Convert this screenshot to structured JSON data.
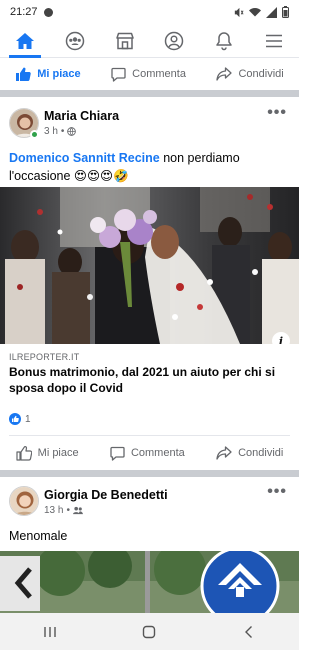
{
  "status_bar": {
    "time": "21:27"
  },
  "nav": {
    "tabs": [
      {
        "icon": "home-icon",
        "active": true
      },
      {
        "icon": "groups-icon",
        "active": false
      },
      {
        "icon": "marketplace-icon",
        "active": false
      },
      {
        "icon": "profile-icon",
        "active": false
      },
      {
        "icon": "bell-icon",
        "active": false
      },
      {
        "icon": "menu-icon",
        "active": false
      }
    ]
  },
  "actions": {
    "like": "Mi piace",
    "comment": "Commenta",
    "share": "Condividi"
  },
  "post1": {
    "author": "Maria Chiara",
    "time": "3 h",
    "mention": "Domenico Sannitt Recine",
    "text": " non perdiamo l'occasione 😍😍😍🤣",
    "link_source": "ILREPORTER.IT",
    "link_title": "Bonus matrimonio, dal 2021 un aiuto per chi si sposa dopo il Covid",
    "like_count": "1"
  },
  "post2": {
    "author": "Giorgia  De Benedetti",
    "time": "13 h",
    "text": "Menomale"
  },
  "colors": {
    "brand": "#1877f2",
    "divider": "#c9ccd1",
    "secondary_text": "#65676b"
  }
}
